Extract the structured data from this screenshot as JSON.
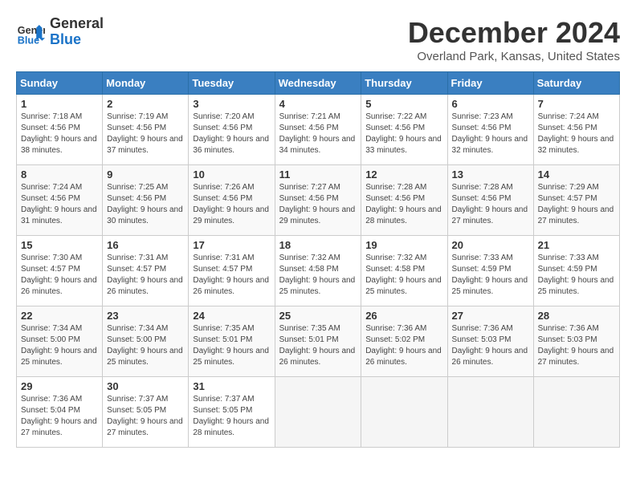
{
  "logo": {
    "line1": "General",
    "line2": "Blue"
  },
  "header": {
    "month": "December 2024",
    "location": "Overland Park, Kansas, United States"
  },
  "days_of_week": [
    "Sunday",
    "Monday",
    "Tuesday",
    "Wednesday",
    "Thursday",
    "Friday",
    "Saturday"
  ],
  "weeks": [
    [
      {
        "day": 1,
        "sunrise": "7:18 AM",
        "sunset": "4:56 PM",
        "daylight": "9 hours and 38 minutes."
      },
      {
        "day": 2,
        "sunrise": "7:19 AM",
        "sunset": "4:56 PM",
        "daylight": "9 hours and 37 minutes."
      },
      {
        "day": 3,
        "sunrise": "7:20 AM",
        "sunset": "4:56 PM",
        "daylight": "9 hours and 36 minutes."
      },
      {
        "day": 4,
        "sunrise": "7:21 AM",
        "sunset": "4:56 PM",
        "daylight": "9 hours and 34 minutes."
      },
      {
        "day": 5,
        "sunrise": "7:22 AM",
        "sunset": "4:56 PM",
        "daylight": "9 hours and 33 minutes."
      },
      {
        "day": 6,
        "sunrise": "7:23 AM",
        "sunset": "4:56 PM",
        "daylight": "9 hours and 32 minutes."
      },
      {
        "day": 7,
        "sunrise": "7:24 AM",
        "sunset": "4:56 PM",
        "daylight": "9 hours and 32 minutes."
      }
    ],
    [
      {
        "day": 8,
        "sunrise": "7:24 AM",
        "sunset": "4:56 PM",
        "daylight": "9 hours and 31 minutes."
      },
      {
        "day": 9,
        "sunrise": "7:25 AM",
        "sunset": "4:56 PM",
        "daylight": "9 hours and 30 minutes."
      },
      {
        "day": 10,
        "sunrise": "7:26 AM",
        "sunset": "4:56 PM",
        "daylight": "9 hours and 29 minutes."
      },
      {
        "day": 11,
        "sunrise": "7:27 AM",
        "sunset": "4:56 PM",
        "daylight": "9 hours and 29 minutes."
      },
      {
        "day": 12,
        "sunrise": "7:28 AM",
        "sunset": "4:56 PM",
        "daylight": "9 hours and 28 minutes."
      },
      {
        "day": 13,
        "sunrise": "7:28 AM",
        "sunset": "4:56 PM",
        "daylight": "9 hours and 27 minutes."
      },
      {
        "day": 14,
        "sunrise": "7:29 AM",
        "sunset": "4:57 PM",
        "daylight": "9 hours and 27 minutes."
      }
    ],
    [
      {
        "day": 15,
        "sunrise": "7:30 AM",
        "sunset": "4:57 PM",
        "daylight": "9 hours and 26 minutes."
      },
      {
        "day": 16,
        "sunrise": "7:31 AM",
        "sunset": "4:57 PM",
        "daylight": "9 hours and 26 minutes."
      },
      {
        "day": 17,
        "sunrise": "7:31 AM",
        "sunset": "4:57 PM",
        "daylight": "9 hours and 26 minutes."
      },
      {
        "day": 18,
        "sunrise": "7:32 AM",
        "sunset": "4:58 PM",
        "daylight": "9 hours and 25 minutes."
      },
      {
        "day": 19,
        "sunrise": "7:32 AM",
        "sunset": "4:58 PM",
        "daylight": "9 hours and 25 minutes."
      },
      {
        "day": 20,
        "sunrise": "7:33 AM",
        "sunset": "4:59 PM",
        "daylight": "9 hours and 25 minutes."
      },
      {
        "day": 21,
        "sunrise": "7:33 AM",
        "sunset": "4:59 PM",
        "daylight": "9 hours and 25 minutes."
      }
    ],
    [
      {
        "day": 22,
        "sunrise": "7:34 AM",
        "sunset": "5:00 PM",
        "daylight": "9 hours and 25 minutes."
      },
      {
        "day": 23,
        "sunrise": "7:34 AM",
        "sunset": "5:00 PM",
        "daylight": "9 hours and 25 minutes."
      },
      {
        "day": 24,
        "sunrise": "7:35 AM",
        "sunset": "5:01 PM",
        "daylight": "9 hours and 25 minutes."
      },
      {
        "day": 25,
        "sunrise": "7:35 AM",
        "sunset": "5:01 PM",
        "daylight": "9 hours and 26 minutes."
      },
      {
        "day": 26,
        "sunrise": "7:36 AM",
        "sunset": "5:02 PM",
        "daylight": "9 hours and 26 minutes."
      },
      {
        "day": 27,
        "sunrise": "7:36 AM",
        "sunset": "5:03 PM",
        "daylight": "9 hours and 26 minutes."
      },
      {
        "day": 28,
        "sunrise": "7:36 AM",
        "sunset": "5:03 PM",
        "daylight": "9 hours and 27 minutes."
      }
    ],
    [
      {
        "day": 29,
        "sunrise": "7:36 AM",
        "sunset": "5:04 PM",
        "daylight": "9 hours and 27 minutes."
      },
      {
        "day": 30,
        "sunrise": "7:37 AM",
        "sunset": "5:05 PM",
        "daylight": "9 hours and 27 minutes."
      },
      {
        "day": 31,
        "sunrise": "7:37 AM",
        "sunset": "5:05 PM",
        "daylight": "9 hours and 28 minutes."
      },
      null,
      null,
      null,
      null
    ]
  ]
}
